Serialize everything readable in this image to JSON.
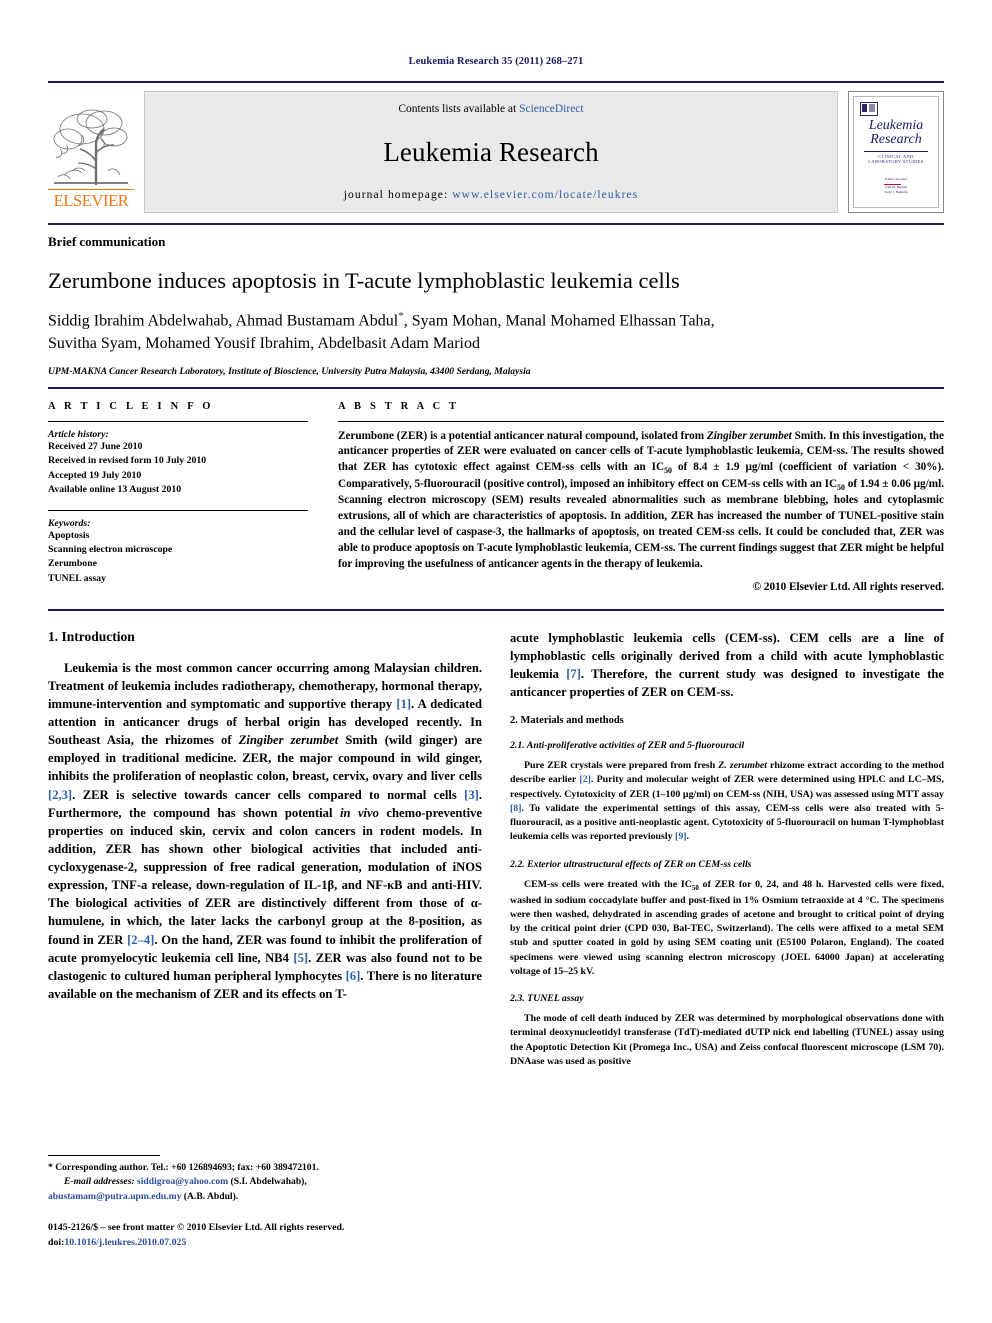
{
  "running_head": "Leukemia Research 35 (2011) 268–271",
  "banner": {
    "contents_prefix": "Contents lists available at ",
    "sciencedirect": "ScienceDirect",
    "journal_title": "Leukemia Research",
    "homepage_label": "journal homepage: ",
    "homepage_url": "www.elsevier.com/locate/leukres",
    "publisher_wordmark": "ELSEVIER",
    "cover": {
      "title_line1": "Leukemia",
      "title_line2": "Research",
      "subtitle": "CLINICAL AND LABORATORY STUDIES",
      "editors_label": "Editors-in-Chief",
      "editor_1": "John M. Bennett",
      "editor_1_loc": "USA",
      "editor_2": "Terry J. Hamblin",
      "editor_2_loc": "UK"
    }
  },
  "article": {
    "kind": "Brief communication",
    "title": "Zerumbone induces apoptosis in T-acute lymphoblastic leukemia cells",
    "authors_line1": "Siddig Ibrahim Abdelwahab, Ahmad Bustamam Abdul",
    "authors_line1_rest": ", Syam Mohan, Manal Mohamed Elhassan Taha,",
    "authors_line2": "Suvitha Syam, Mohamed Yousif Ibrahim, Abdelbasit Adam Mariod",
    "corresponding_marker": "*",
    "affiliation": "UPM-MAKNA Cancer Research Laboratory, Institute of Bioscience, University Putra Malaysia, 43400 Serdang, Malaysia"
  },
  "info": {
    "heading": "A R T I C L E   I N F O",
    "history_label": "Article history:",
    "history": [
      "Received 27 June 2010",
      "Received in revised form 10 July 2010",
      "Accepted 19 July 2010",
      "Available online 13 August 2010"
    ],
    "keywords_label": "Keywords:",
    "keywords": [
      "Apoptosis",
      "Scanning electron microscope",
      "Zerumbone",
      "TUNEL assay"
    ]
  },
  "abstract": {
    "heading": "A B S T R A C T",
    "part1": "Zerumbone (ZER) is a potential anticancer natural compound, isolated from ",
    "species": "Zingiber zerumbet",
    "part2": " Smith. In this investigation, the anticancer properties of ZER were evaluated on cancer cells of T-acute lymphoblastic leukemia, CEM-ss. The results showed that ZER has cytotoxic effect against CEM-ss cells with an IC",
    "sub1": "50",
    "part3": " of 8.4 ± 1.9 µg/ml (coefficient of variation < 30%). Comparatively, 5-fluorouracil (positive control), imposed an inhibitory effect on CEM-ss cells with an IC",
    "sub2": "50",
    "part4": " of 1.94 ± 0.06 µg/ml. Scanning electron microscopy (SEM) results revealed abnormalities such as membrane blebbing, holes and cytoplasmic extrusions, all of which are characteristics of apoptosis. In addition, ZER has increased the number of TUNEL-positive stain and the cellular level of caspase-3, the hallmarks of apoptosis, on treated CEM-ss cells. It could be concluded that, ZER was able to produce apoptosis on T-acute lymphoblastic leukemia, CEM-ss. The current findings suggest that ZER might be helpful for improving the usefulness of anticancer agents in the therapy of leukemia.",
    "copyright": "© 2010 Elsevier Ltd. All rights reserved."
  },
  "sections": {
    "intro_heading": "1.  Introduction",
    "intro_p1_a": "Leukemia is the most common cancer occurring among Malaysian children. Treatment of leukemia includes radiotherapy, chemotherapy, hormonal therapy, immune-intervention and symptomatic and supportive therapy ",
    "intro_ref1": "[1]",
    "intro_p1_b": ". A dedicated attention in anticancer drugs of herbal origin has developed recently. In Southeast Asia, the rhizomes of ",
    "intro_species": "Zingiber zerumbet",
    "intro_p1_c": " Smith (wild ginger) are employed in traditional medicine. ZER, the major compound in wild ginger, inhibits the proliferation of neoplastic colon, breast, cervix, ovary and liver cells ",
    "intro_ref2": "[2,3]",
    "intro_p1_d": ". ZER is selective towards cancer cells compared to normal cells ",
    "intro_ref3": "[3]",
    "intro_p1_e": ". Furthermore, the compound has shown potential ",
    "intro_invivo": "in vivo",
    "intro_p1_f": " chemo-preventive properties on induced skin, cervix and colon cancers in rodent models. In addition, ZER has shown other biological activities that included anti-cycloxygenase-2, suppression of free radical generation, modulation of iNOS expression, TNF-a release, down-regulation of IL-1β, and NF-κB and anti-HIV. The biological activities of ZER are distinctively different from those of α-humulene, in which, the later lacks the carbonyl group at the 8-position, as found in ZER ",
    "intro_ref4": "[2–4]",
    "intro_p1_g": ". On the hand, ZER was found to inhibit the proliferation of acute promyelocytic leukemia cell line, NB4 ",
    "intro_ref5": "[5]",
    "intro_p1_h": ". ZER was also found not to be clastogenic to cultured human peripheral lymphocytes ",
    "intro_ref6": "[6]",
    "intro_p1_i": ". There is no literature available on the mechanism of ZER and its effects on T-acute lymphoblastic leukemia cells (CEM-ss). CEM cells are a line of lymphoblastic cells originally derived from a child with acute lymphoblastic leukemia ",
    "intro_ref7": "[7]",
    "intro_p1_j": ". Therefore, the current study was designed to investigate the anticancer properties of ZER on CEM-ss.",
    "methods_heading": "2.  Materials and methods",
    "sub21_heading": "2.1.  Anti-proliferative activities of ZER and 5-fluorouracil",
    "sub21_a": "Pure ZER crystals were prepared from fresh ",
    "sub21_species": "Z. zerumbet",
    "sub21_b": " rhizome extract according to the method describe earlier ",
    "sub21_ref1": "[2]",
    "sub21_c": ". Purity and molecular weight of ZER were determined using HPLC and LC–MS, respectively. Cytotoxicity of ZER (1–100 µg/ml) on CEM-ss (NIH, USA) was assessed using MTT assay ",
    "sub21_ref2": "[8]",
    "sub21_d": ". To validate the experimental settings of this assay, CEM-ss cells were also treated with 5-fluorouracil, as a positive anti-neoplastic agent. Cytotoxicity of 5-fluorouracil on human T-lymphoblast leukemia cells was reported previously ",
    "sub21_ref3": "[9]",
    "sub21_e": ".",
    "sub22_heading": "2.2.  Exterior ultrastructural effects of ZER on CEM-ss cells",
    "sub22_a": "CEM-ss cells were treated with the IC",
    "sub22_sub": "50",
    "sub22_b": " of ZER for 0, 24, and 48 h. Harvested cells were fixed, washed in sodium coccadylate buffer and post-fixed in 1% Osmium tetraoxide at 4 °C. The specimens were then washed, dehydrated in ascending grades of acetone and brought to critical point of drying by the critical point drier (CPD 030, Bal-TEC, Switzerland). The cells were affixed to a metal SEM stub and sputter coated in gold by using SEM coating unit (E5100 Polaron, England). The coated specimens were viewed using scanning electron microscopy (JOEL 64000 Japan) at accelerating voltage of 15–25 kV.",
    "sub23_heading": "2.3.  TUNEL assay",
    "sub23_a": "The mode of cell death induced by ZER was determined by morphological observations done with terminal deoxynucleotidyl transferase (TdT)-mediated dUTP nick end labelling (TUNEL) assay using the Apoptotic Detection Kit (Promega Inc., USA) and Zeiss confocal fluorescent microscope (LSM 70). DNAase was used as positive"
  },
  "footnote": {
    "star": "*",
    "corresponding": " Corresponding author. Tel.: +60 126894693; fax: +60 389472101.",
    "email_label": "E-mail addresses:",
    "email1": "siddigroa@yahoo.com",
    "email1_owner": " (S.I. Abdelwahab),",
    "email2": "abustamam@putra.upm.edu.my",
    "email2_owner": " (A.B. Abdul).",
    "issn_line": "0145-2126/$ – see front matter © 2010 Elsevier Ltd. All rights reserved.",
    "doi_label": "doi:",
    "doi": "10.1016/j.leukres.2010.07.025"
  }
}
